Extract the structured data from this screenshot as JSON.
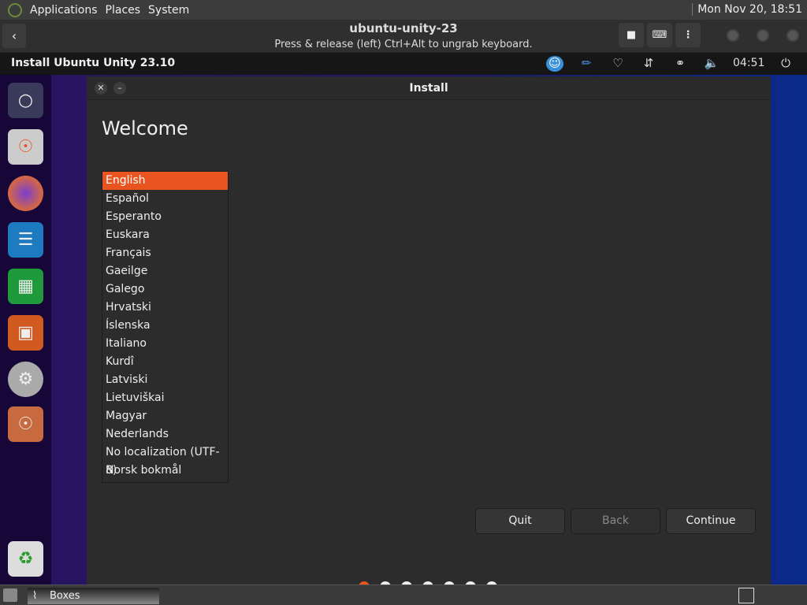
{
  "top_panel": {
    "menus": [
      "Applications",
      "Places",
      "System"
    ],
    "clock": "Mon Nov 20, 18:51"
  },
  "boxes_header": {
    "title": "ubuntu-unity-23",
    "subtitle": "Press & release (left) Ctrl+Alt to ungrab keyboard."
  },
  "unity_bar": {
    "title": "Install Ubuntu Unity 23.10",
    "time": "04:51"
  },
  "window": {
    "title": "Install",
    "heading": "Welcome",
    "languages": [
      "English",
      "Español",
      "Esperanto",
      "Euskara",
      "Français",
      "Gaeilge",
      "Galego",
      "Hrvatski",
      "Íslenska",
      "Italiano",
      "Kurdî",
      "Latviski",
      "Lietuviškai",
      "Magyar",
      "Nederlands",
      "No localization (UTF-8)",
      "Norsk bokmål"
    ],
    "selected_index": 0,
    "buttons": {
      "quit": "Quit",
      "back": "Back",
      "continue": "Continue"
    },
    "progress": {
      "total_steps": 7,
      "current_step": 1
    }
  },
  "taskbar": {
    "task": "Boxes"
  },
  "colors": {
    "accent": "#e95420"
  }
}
